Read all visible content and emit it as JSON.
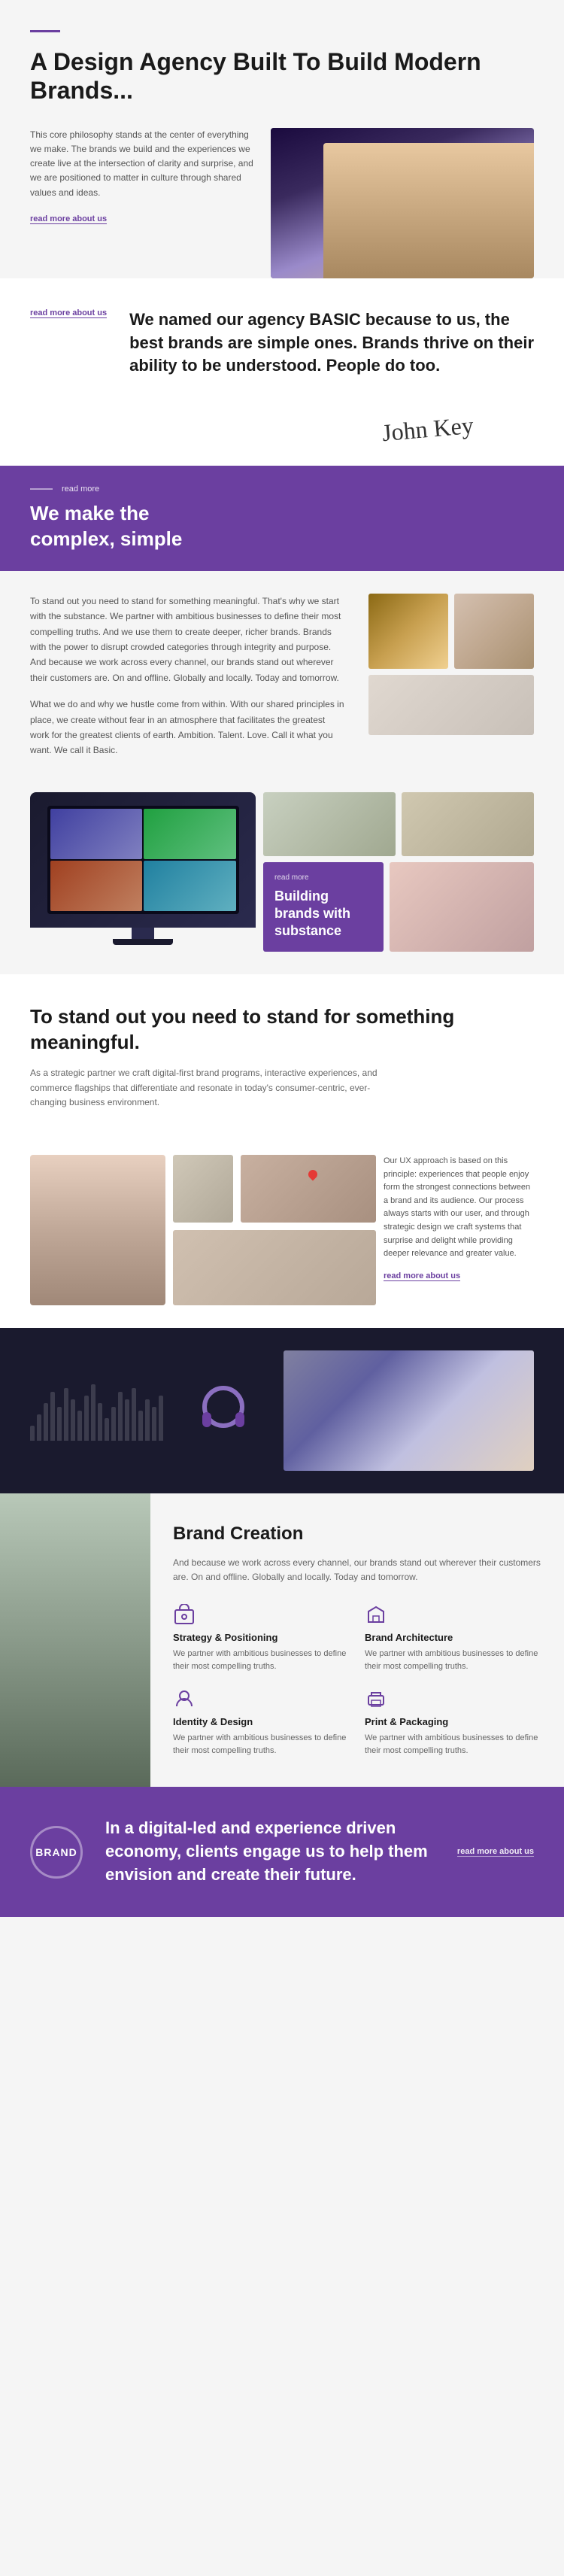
{
  "hero": {
    "accent": "",
    "title": "A Design Agency Built To Build Modern Brands...",
    "text": "This core philosophy stands at the center of everything we make. The brands we build and the experiences we create live at the intersection of clarity and surprise, and we are positioned to matter in culture through shared values and ideas.",
    "read_more": "read more about us"
  },
  "quote": {
    "read_more": "read more about us",
    "text": "We named our agency BASIC because to us, the best brands are simple ones. Brands thrive on their ability to be understood. People do too."
  },
  "signature": "John Key",
  "purple_banner": {
    "read_more": "read more",
    "title": "We make the\ncomplex, simple"
  },
  "middle": {
    "paragraph1": "To stand out you need to stand for something meaningful. That's why we start with the substance. We partner with ambitious businesses to define their most compelling truths. And we use them to create deeper, richer brands. Brands with the power to disrupt crowded categories through integrity and purpose. And because we work across every channel, our brands stand out wherever their customers are. On and offline. Globally and locally. Today and tomorrow.",
    "paragraph2": "What we do and why we hustle come from within. With our shared principles in place, we create without fear in an atmosphere that facilitates the greatest work for the greatest clients of earth. Ambition. Talent. Love. Call it what you want. We call it Basic."
  },
  "portfolio_card": {
    "read_more": "read more",
    "title": "Building brands with substance"
  },
  "standout": {
    "title": "To stand out you need to stand for something meaningful.",
    "text": "As a strategic partner we craft digital-first brand programs, interactive experiences, and commerce flagships that differentiate and resonate in today's consumer-centric, ever-changing business environment."
  },
  "img_row": {
    "body": "Our UX approach is based on this principle: experiences that people enjoy form the strongest connections between a brand and its audience. Our process always starts with our user, and through strategic design we craft systems that surprise and delight while providing deeper relevance and greater value.",
    "read_more": "read more about us"
  },
  "brand_creation": {
    "title": "Brand Creation",
    "intro": "And because we work across every channel, our brands stand out wherever their customers are. On and offline. Globally and locally. Today and tomorrow.",
    "services": [
      {
        "icon": "strategy-icon",
        "title": "Strategy & Positioning",
        "text": "We partner with ambitious businesses to define their most compelling truths."
      },
      {
        "icon": "architecture-icon",
        "title": "Brand Architecture",
        "text": "We partner with ambitious businesses to define their most compelling truths."
      },
      {
        "icon": "identity-icon",
        "title": "Identity & Design",
        "text": "We partner with ambitious businesses to define their most compelling truths."
      },
      {
        "icon": "print-icon",
        "title": "Print & Packaging",
        "text": "We partner with ambitious businesses to define their most compelling truths."
      }
    ]
  },
  "footer": {
    "brand_logo": "BRAND",
    "text": "In a digital-led and experience driven economy, clients engage us to help them envision and create their future.",
    "read_more": "read more about us"
  }
}
